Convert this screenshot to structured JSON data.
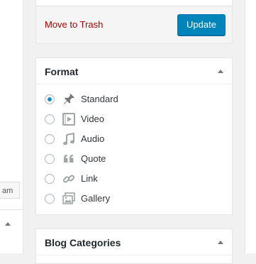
{
  "left": {
    "fragment_text": "am"
  },
  "publish": {
    "trash_label": "Move to Trash",
    "update_label": "Update"
  },
  "format": {
    "title": "Format",
    "options": [
      {
        "label": "Standard",
        "icon": "pin-icon",
        "checked": true
      },
      {
        "label": "Video",
        "icon": "video-icon",
        "checked": false
      },
      {
        "label": "Audio",
        "icon": "audio-icon",
        "checked": false
      },
      {
        "label": "Quote",
        "icon": "quote-icon",
        "checked": false
      },
      {
        "label": "Link",
        "icon": "link-icon",
        "checked": false
      },
      {
        "label": "Gallery",
        "icon": "gallery-icon",
        "checked": false
      }
    ]
  },
  "blog_categories": {
    "title": "Blog Categories"
  },
  "colors": {
    "primary_button": "#0085ba",
    "trash_link": "#aa0000",
    "radio_checked": "#1e8cbe",
    "icon_grey": "#a0a5aa"
  }
}
